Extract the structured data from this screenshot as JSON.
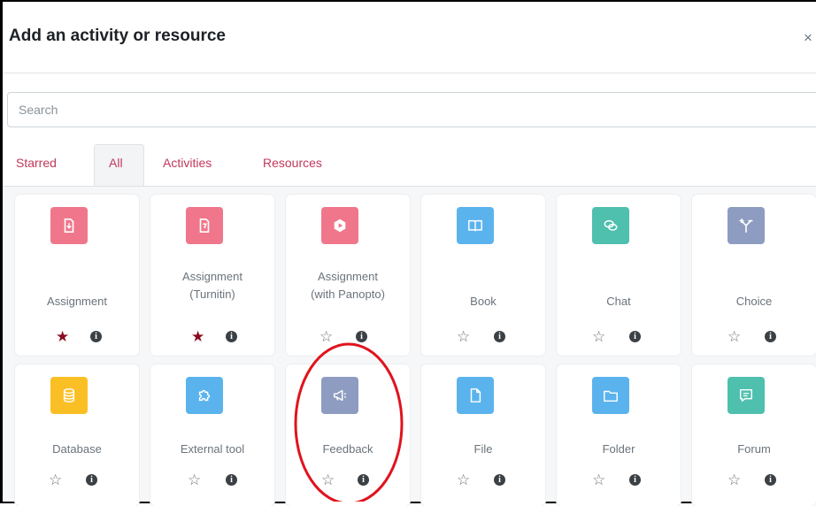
{
  "dialog": {
    "title": "Add an activity or resource",
    "close_glyph": "×"
  },
  "search": {
    "placeholder": "Search"
  },
  "tabs": [
    {
      "label": "Starred",
      "active": false
    },
    {
      "label": "All",
      "active": true
    },
    {
      "label": "Activities",
      "active": false
    },
    {
      "label": "Resources",
      "active": false
    }
  ],
  "colors": {
    "link": "#c0385e",
    "star_filled": "#8b0a1f",
    "assessment": "#f0778b",
    "content": "#5bb3ed",
    "communication": "#4fbfae",
    "collaboration": "#8e9cc1",
    "administration": "#f9bf24",
    "highlight": "#e0131d"
  },
  "modules": [
    {
      "name": "Assignment",
      "icon": "assignment-icon",
      "color": "#f0778b",
      "starred": true
    },
    {
      "name": "Assignment (Turnitin)",
      "icon": "turnitin-assignment-icon",
      "color": "#f0778b",
      "starred": true
    },
    {
      "name": "Assignment (with Panopto)",
      "icon": "panopto-play-icon",
      "color": "#f0778b",
      "starred": false
    },
    {
      "name": "Book",
      "icon": "book-icon",
      "color": "#5bb3ed",
      "starred": false
    },
    {
      "name": "Chat",
      "icon": "chat-icon",
      "color": "#4fbfae",
      "starred": false
    },
    {
      "name": "Choice",
      "icon": "choice-icon",
      "color": "#8e9cc1",
      "starred": false
    },
    {
      "name": "Database",
      "icon": "database-icon",
      "color": "#f9bf24",
      "starred": false
    },
    {
      "name": "External tool",
      "icon": "puzzle-icon",
      "color": "#5bb3ed",
      "starred": false
    },
    {
      "name": "Feedback",
      "icon": "megaphone-icon",
      "color": "#8e9cc1",
      "starred": false
    },
    {
      "name": "File",
      "icon": "file-icon",
      "color": "#5bb3ed",
      "starred": false
    },
    {
      "name": "Folder",
      "icon": "folder-icon",
      "color": "#5bb3ed",
      "starred": false
    },
    {
      "name": "Forum",
      "icon": "forum-icon",
      "color": "#4fbfae",
      "starred": false
    }
  ],
  "labels": {
    "assignment": "Assignment",
    "turnitin_l1": "Assignment",
    "turnitin_l2": "(Turnitin)",
    "panopto_l1": "Assignment",
    "panopto_l2": "(with Panopto)",
    "book": "Book",
    "chat": "Chat",
    "choice": "Choice",
    "database": "Database",
    "external_tool": "External tool",
    "feedback": "Feedback",
    "file": "File",
    "folder": "Folder",
    "forum": "Forum"
  },
  "glyphs": {
    "star_filled": "★",
    "star_empty": "☆",
    "info": "i"
  }
}
